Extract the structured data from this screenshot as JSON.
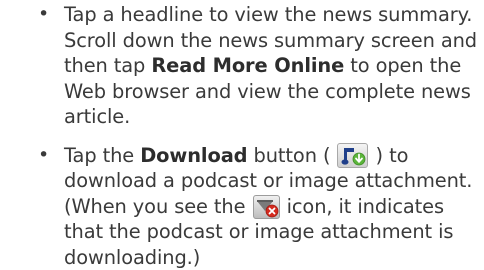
{
  "items": [
    {
      "bullet": "•",
      "text_a": "Tap a headline to view the news summary. Scroll down the news summary screen and then tap ",
      "bold": "Read More Online",
      "text_b": " to open the Web browser and view the complete news article."
    },
    {
      "bullet": "•",
      "text_a": "Tap the ",
      "bold": "Download",
      "text_b": " button ( ",
      "icon1": "download-podcast-icon",
      "text_c": " ) to download a podcast or image attachment. (When you see the ",
      "icon2": "downloading-indicator-icon",
      "text_d": " icon, it indicates that the podcast or image attachment is downloading.)"
    }
  ],
  "colors": {
    "text": "#3a3a3a",
    "icon_green": "#5bb53a",
    "icon_red": "#d42a1e"
  }
}
